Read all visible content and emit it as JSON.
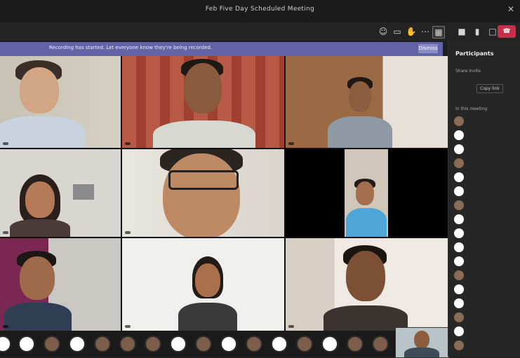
{
  "window": {
    "title": "Feb Five Day Scheduled Meeting"
  },
  "banner": {
    "text": "Recording has started. Let everyone know they're being recorded.",
    "button": "Dismiss"
  },
  "toolbar": {
    "icons": [
      "people-icon",
      "chat-icon",
      "raise-hand-icon",
      "more-icon",
      "grid-icon",
      "camera-icon",
      "mic-icon",
      "share-icon"
    ],
    "leave_label": "Leave"
  },
  "participants_panel": {
    "title": "Participants",
    "share_text": "Share invite",
    "copy_label": "Copy link",
    "section_label": "In this meeting",
    "rows": [
      "",
      "",
      "",
      "",
      "",
      "",
      "",
      "",
      "",
      "",
      "",
      "",
      "",
      "",
      "",
      "",
      ""
    ]
  },
  "tiles": [
    {
      "name": ""
    },
    {
      "name": ""
    },
    {
      "name": ""
    },
    {
      "name": ""
    },
    {
      "name": ""
    },
    {
      "name": ""
    },
    {
      "name": ""
    },
    {
      "name": ""
    },
    {
      "name": ""
    }
  ],
  "colors": {
    "accent": "#6264a7",
    "leave": "#c4314b"
  }
}
